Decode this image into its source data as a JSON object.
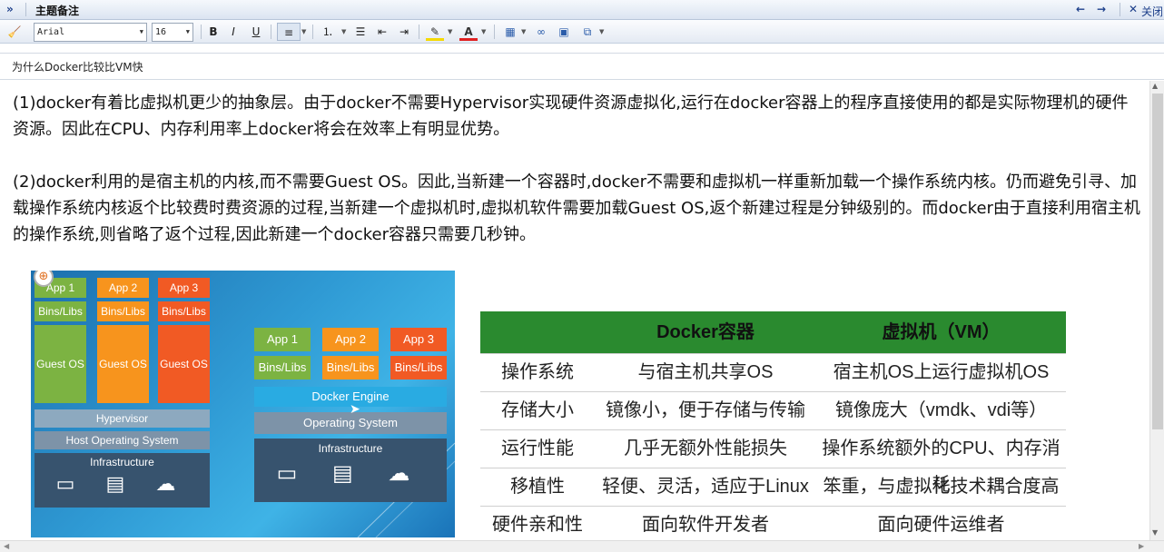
{
  "window": {
    "title": "主题备注",
    "close_label": "关闭"
  },
  "toolbar": {
    "font": "Arial",
    "size": "16"
  },
  "subject": "为什么Docker比较比VM快",
  "paragraphs": [
    "(1)docker有着比虚拟机更少的抽象层。由于docker不需要Hypervisor实现硬件资源虚拟化,运行在docker容器上的程序直接使用的都是实际物理机的硬件资源。因此在CPU、内存利用率上docker将会在效率上有明显优势。",
    "(2)docker利用的是宿主机的内核,而不需要Guest OS。因此,当新建一个容器时,docker不需要和虚拟机一样重新加载一个操作系统内核。仍而避免引寻、加载操作系统内核返个比较费时费资源的过程,当新建一个虚拟机时,虚拟机软件需要加载Guest OS,返个新建过程是分钟级别的。而docker由于直接利用宿主机的操作系统,则省略了返个过程,因此新建一个docker容器只需要几秒钟。"
  ],
  "diagram": {
    "vm": {
      "apps": [
        "App 1",
        "App 2",
        "App 3"
      ],
      "libs": [
        "Bins/Libs",
        "Bins/Libs",
        "Bins/Libs"
      ],
      "guest": [
        "Guest OS",
        "Guest OS",
        "Guest OS"
      ],
      "hypervisor": "Hypervisor",
      "host_os": "Host Operating System",
      "infra": "Infrastructure"
    },
    "docker": {
      "apps": [
        "App 1",
        "App 2",
        "App 3"
      ],
      "libs": [
        "Bins/Libs",
        "Bins/Libs",
        "Bins/Libs"
      ],
      "engine": "Docker Engine",
      "os": "Operating System",
      "infra": "Infrastructure"
    }
  },
  "table": {
    "headers": [
      "",
      "Docker容器",
      "虚拟机（VM）"
    ],
    "rows": [
      [
        "操作系统",
        "与宿主机共享OS",
        "宿主机OS上运行虚拟机OS"
      ],
      [
        "存储大小",
        "镜像小，便于存储与传输",
        "镜像庞大（vmdk、vdi等）"
      ],
      [
        "运行性能",
        "几乎无额外性能损失",
        "操作系统额外的CPU、内存消耗"
      ],
      [
        "移植性",
        "轻便、灵活，适应于Linux",
        "笨重，与虚拟化技术耦合度高"
      ],
      [
        "硬件亲和性",
        "面向软件开发者",
        "面向硬件运维者"
      ]
    ]
  },
  "colors": {
    "vm_app": "#7cb342",
    "vm_app2": "#f7941d",
    "vm_app3": "#f15a24",
    "table_header": "#2a8a2f",
    "docker_engine": "#29abe2"
  }
}
